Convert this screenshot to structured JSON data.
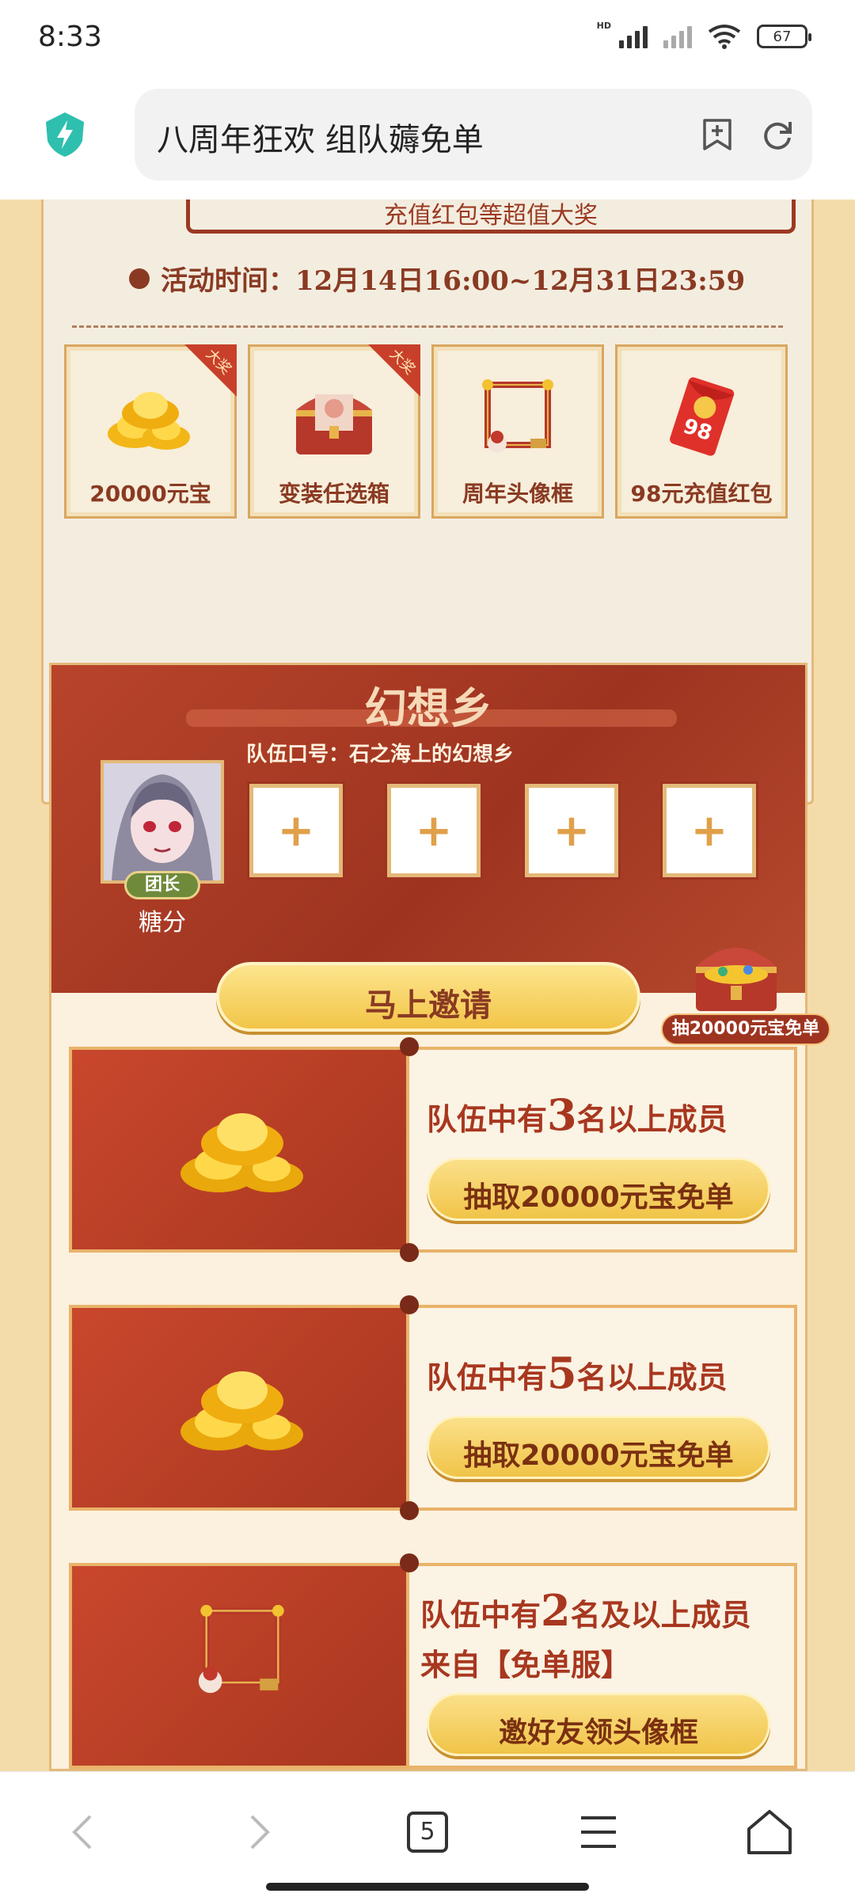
{
  "status": {
    "time": "8:33",
    "battery": "67",
    "hd": "HD"
  },
  "browser": {
    "url_title": "八周年狂欢 组队薅免单",
    "tab_count": "5"
  },
  "event": {
    "banner_subtitle": "充值红包等超值大奖",
    "time_text": "活动时间：12月14日16:00~12月31日23:59",
    "prizes": [
      {
        "label": "20000元宝",
        "ribbon": "大奖"
      },
      {
        "label": "变装任选箱",
        "ribbon": "大奖"
      },
      {
        "label": "周年头像框"
      },
      {
        "label": "98元充值红包",
        "packet_number": "98"
      }
    ]
  },
  "team": {
    "name": "幻想乡",
    "slogan": "队伍口号：石之海上的幻想乡",
    "leader_badge": "团长",
    "leader_name": "糖分",
    "slot_symbol": "+",
    "invite_label": "马上邀请",
    "chest_label": "抽20000元宝免单"
  },
  "tasks": [
    {
      "title_pre": "队伍中有",
      "num": "3",
      "title_post": "名以上成员",
      "button": "抽取20000元宝免单"
    },
    {
      "title_pre": "队伍中有",
      "num": "5",
      "title_post": "名以上成员",
      "button": "抽取20000元宝免单"
    },
    {
      "title_pre": "队伍中有",
      "num": "2",
      "title_post": "名及以上成员",
      "line2": "来自【免单服】",
      "button": "邀好友领头像框"
    }
  ]
}
